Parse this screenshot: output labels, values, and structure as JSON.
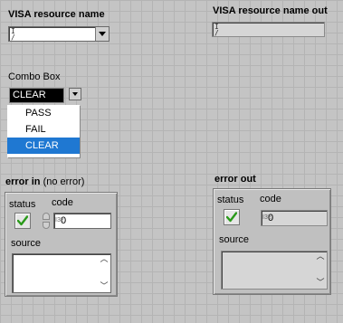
{
  "visa_in": {
    "label": "VISA resource name",
    "value": "",
    "io_glyph": "I/O"
  },
  "visa_out": {
    "label": "VISA resource name out",
    "value": "",
    "io_glyph": "I/O"
  },
  "combo": {
    "label": "Combo Box",
    "value": "CLEAR",
    "options": [
      "PASS",
      "FAIL",
      "CLEAR"
    ],
    "selected_index": 2
  },
  "error_in": {
    "title": "error in",
    "title_suffix": "(no error)",
    "status_label": "status",
    "code_label": "code",
    "code_value": "0",
    "source_label": "source",
    "source_value": "",
    "status_icon": "check-icon"
  },
  "error_out": {
    "title": "error out",
    "status_label": "status",
    "code_label": "code",
    "code_value": "0",
    "source_label": "source",
    "source_value": "",
    "status_icon": "check-icon"
  },
  "colors": {
    "check_green": "#2a9a1a",
    "selection_blue": "#1f78d2",
    "panel_bg": "#c4c4c4"
  }
}
